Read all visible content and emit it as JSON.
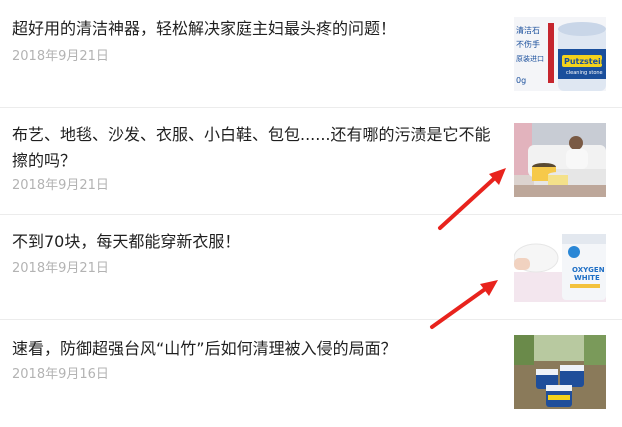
{
  "articles": [
    {
      "title": "超好用的清洁神器，轻松解决家庭主妇最头疼的问题！",
      "date": "2018年9月21日",
      "thumb_lines": [
        "清洁石",
        "不伤手",
        "原装进口",
        "Putzstein",
        "cleaning stone",
        "0g"
      ]
    },
    {
      "title": "布艺、地毯、沙发、衣服、小白鞋、包包......还有哪的污渍是它不能擦的吗？",
      "date": "2018年9月21日"
    },
    {
      "title": "不到70块，每天都能穿新衣服！",
      "date": "2018年9月21日",
      "thumb_lines": [
        "OXYGEN",
        "WHITE"
      ]
    },
    {
      "title": "速看，防御超强台风“山竹”后如何清理被入侵的局面？",
      "date": "2018年9月16日"
    }
  ],
  "colors": {
    "title": "#1f1f1f",
    "date": "#b3b3b3",
    "divider": "#ececec",
    "arrow": "#e8231d"
  }
}
